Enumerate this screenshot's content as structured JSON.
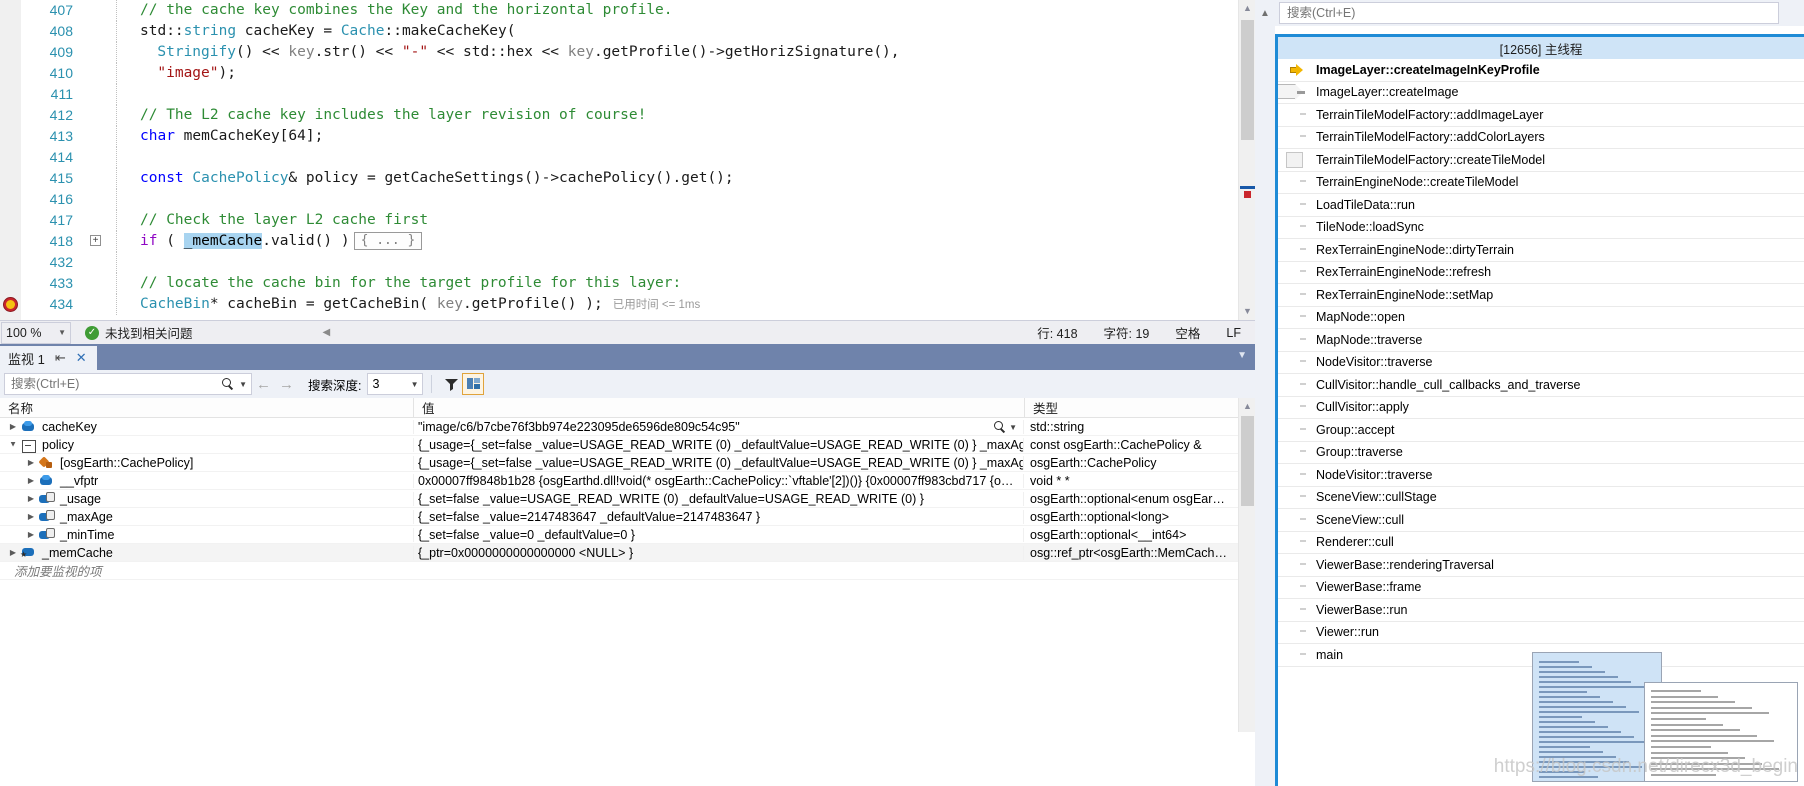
{
  "editor": {
    "zoom": "100 %",
    "issue_status": "未找到相关问题",
    "status_line": "行: 418",
    "status_char": "字符: 19",
    "status_spaces": "空格",
    "status_eol": "LF",
    "lines": [
      {
        "num": "407",
        "outline": "",
        "segments": [
          {
            "text": "// the cache key combines the Key and the horizontal profile.",
            "cls": "c-comment"
          }
        ]
      },
      {
        "num": "408",
        "outline": "",
        "segments": [
          {
            "text": "std",
            "cls": "c-plain"
          },
          {
            "text": "::",
            "cls": "c-plain"
          },
          {
            "text": "string",
            "cls": "c-type"
          },
          {
            "text": " cacheKey = ",
            "cls": "c-plain"
          },
          {
            "text": "Cache",
            "cls": "c-type"
          },
          {
            "text": "::makeCacheKey(",
            "cls": "c-plain"
          }
        ]
      },
      {
        "num": "409",
        "outline": "",
        "indent": 2,
        "segments": [
          {
            "text": "Stringify",
            "cls": "c-type"
          },
          {
            "text": "() << ",
            "cls": "c-plain"
          },
          {
            "text": "key",
            "cls": "c-var"
          },
          {
            "text": ".str() << ",
            "cls": "c-plain"
          },
          {
            "text": "\"-\"",
            "cls": "c-str"
          },
          {
            "text": " << std::hex << ",
            "cls": "c-plain"
          },
          {
            "text": "key",
            "cls": "c-var"
          },
          {
            "text": ".getProfile()->getHorizSignature(),",
            "cls": "c-plain"
          }
        ]
      },
      {
        "num": "410",
        "outline": "",
        "indent": 2,
        "segments": [
          {
            "text": "\"image\"",
            "cls": "c-str"
          },
          {
            "text": ");",
            "cls": "c-plain"
          }
        ]
      },
      {
        "num": "411",
        "outline": "",
        "segments": []
      },
      {
        "num": "412",
        "outline": "",
        "segments": [
          {
            "text": "// The L2 cache key includes the layer revision of course!",
            "cls": "c-comment"
          }
        ]
      },
      {
        "num": "413",
        "outline": "",
        "segments": [
          {
            "text": "char",
            "cls": "c-kw"
          },
          {
            "text": " memCacheKey[",
            "cls": "c-plain"
          },
          {
            "text": "64",
            "cls": "c-num"
          },
          {
            "text": "];",
            "cls": "c-plain"
          }
        ]
      },
      {
        "num": "414",
        "outline": "",
        "segments": []
      },
      {
        "num": "415",
        "outline": "",
        "segments": [
          {
            "text": "const",
            "cls": "c-kw"
          },
          {
            "text": " ",
            "cls": "c-plain"
          },
          {
            "text": "CachePolicy",
            "cls": "c-type"
          },
          {
            "text": "& policy = getCacheSettings()->cachePolicy().get();",
            "cls": "c-plain"
          }
        ]
      },
      {
        "num": "416",
        "outline": "",
        "segments": []
      },
      {
        "num": "417",
        "outline": "",
        "segments": [
          {
            "text": "// Check the layer L2 cache first",
            "cls": "c-comment"
          }
        ]
      },
      {
        "num": "418",
        "outline": "+",
        "segments": [
          {
            "text": "if",
            "cls": "c-ctl"
          },
          {
            "text": " ( ",
            "cls": "c-plain"
          },
          {
            "text": "_memCache",
            "cls": "sel-token"
          },
          {
            "text": ".valid() )",
            "cls": "c-plain"
          }
        ],
        "collapsed": "{ ... }"
      },
      {
        "num": "432",
        "outline": "",
        "segments": []
      },
      {
        "num": "433",
        "outline": "",
        "segments": [
          {
            "text": "// locate the cache bin for the target profile for this layer:",
            "cls": "c-comment"
          }
        ]
      },
      {
        "num": "434",
        "outline": "",
        "breakpoint": true,
        "segments": [
          {
            "text": "CacheBin",
            "cls": "c-type"
          },
          {
            "text": "* cacheBin = getCacheBin( ",
            "cls": "c-plain"
          },
          {
            "text": "key",
            "cls": "c-var"
          },
          {
            "text": ".getProfile() );",
            "cls": "c-plain"
          }
        ],
        "elapsed": "已用时间 <= 1ms"
      }
    ]
  },
  "watch": {
    "tab_label": "监视 1",
    "pin_icon": "pin-icon",
    "close_icon": "close-icon",
    "search_placeholder": "搜索(Ctrl+E)",
    "search_value": "",
    "depth_label": "搜索深度:",
    "depth_value": "3",
    "columns": [
      "名称",
      "值",
      "类型"
    ],
    "add_item_hint": "添加要监视的项",
    "rows": [
      {
        "name": "cacheKey",
        "indent": 0,
        "icon": "field",
        "expander": "collapsed",
        "value": "\"image/c6/b7cbe76f3bb974e223095de6596de809c54c95\"",
        "type": "std::string",
        "has_search": true,
        "highlight": false
      },
      {
        "name": "policy",
        "indent": 0,
        "icon": "expander-box",
        "expander": "expanded",
        "value": "{_usage={_set=false _value=USAGE_READ_WRITE (0) _defaultValue=USAGE_READ_WRITE (0) } _maxAge…",
        "type": "const osgEarth::CachePolicy &",
        "has_search": false,
        "highlight": false
      },
      {
        "name": "[osgEarth::CachePolicy]",
        "indent": 1,
        "icon": "base",
        "expander": "collapsed",
        "value": "{_usage={_set=false _value=USAGE_READ_WRITE (0) _defaultValue=USAGE_READ_WRITE (0) } _maxAge…",
        "type": "osgEarth::CachePolicy",
        "has_search": false,
        "highlight": false
      },
      {
        "name": "__vfptr",
        "indent": 1,
        "icon": "field",
        "expander": "collapsed",
        "value": "0x00007ff9848b1b28 {osgEarthd.dll!void(* osgEarth::CachePolicy::`vftable'[2])()} {0x00007ff983cbd717 {o…",
        "type": "void * *",
        "has_search": false,
        "highlight": false
      },
      {
        "name": "_usage",
        "indent": 1,
        "icon": "priv",
        "expander": "collapsed",
        "value": "{_set=false _value=USAGE_READ_WRITE (0) _defaultValue=USAGE_READ_WRITE (0) }",
        "type": "osgEarth::optional<enum osgEar…",
        "has_search": false,
        "highlight": false
      },
      {
        "name": "_maxAge",
        "indent": 1,
        "icon": "priv",
        "expander": "collapsed",
        "value": "{_set=false _value=2147483647 _defaultValue=2147483647 }",
        "type": "osgEarth::optional<long>",
        "has_search": false,
        "highlight": false
      },
      {
        "name": "_minTime",
        "indent": 1,
        "icon": "priv",
        "expander": "collapsed",
        "value": "{_set=false _value=0 _defaultValue=0 }",
        "type": "osgEarth::optional<__int64>",
        "has_search": false,
        "highlight": false
      },
      {
        "name": "_memCache",
        "indent": 0,
        "icon": "refptr",
        "expander": "collapsed",
        "value": "{_ptr=0x0000000000000000 <NULL> }",
        "type": "osg::ref_ptr<osgEarth::MemCach…",
        "has_search": false,
        "highlight": true
      }
    ]
  },
  "callstack": {
    "search_placeholder": "搜索(Ctrl+E)",
    "search_value": "",
    "thread_header": "[12656] 主线程",
    "frames": [
      {
        "label": "ImageLayer::createImageInKeyProfile",
        "marker": "current-arrow"
      },
      {
        "label": "ImageLayer::createImage",
        "marker": "ghost"
      },
      {
        "label": "TerrainTileModelFactory::addImageLayer",
        "marker": ""
      },
      {
        "label": "TerrainTileModelFactory::addColorLayers",
        "marker": ""
      },
      {
        "label": "TerrainTileModelFactory::createTileModel",
        "marker": "box"
      },
      {
        "label": "TerrainEngineNode::createTileModel",
        "marker": ""
      },
      {
        "label": "LoadTileData::run",
        "marker": ""
      },
      {
        "label": "TileNode::loadSync",
        "marker": ""
      },
      {
        "label": "RexTerrainEngineNode::dirtyTerrain",
        "marker": ""
      },
      {
        "label": "RexTerrainEngineNode::refresh",
        "marker": ""
      },
      {
        "label": "RexTerrainEngineNode::setMap",
        "marker": ""
      },
      {
        "label": "MapNode::open",
        "marker": ""
      },
      {
        "label": "MapNode::traverse",
        "marker": ""
      },
      {
        "label": "NodeVisitor::traverse",
        "marker": ""
      },
      {
        "label": "CullVisitor::handle_cull_callbacks_and_traverse",
        "marker": ""
      },
      {
        "label": "CullVisitor::apply",
        "marker": ""
      },
      {
        "label": "Group::accept",
        "marker": ""
      },
      {
        "label": "Group::traverse",
        "marker": ""
      },
      {
        "label": "NodeVisitor::traverse",
        "marker": ""
      },
      {
        "label": "SceneView::cullStage",
        "marker": ""
      },
      {
        "label": "SceneView::cull",
        "marker": ""
      },
      {
        "label": "Renderer::cull",
        "marker": ""
      },
      {
        "label": "ViewerBase::renderingTraversal",
        "marker": ""
      },
      {
        "label": "ViewerBase::frame",
        "marker": ""
      },
      {
        "label": "ViewerBase::run",
        "marker": ""
      },
      {
        "label": "Viewer::run",
        "marker": ""
      },
      {
        "label": "main",
        "marker": ""
      }
    ]
  },
  "watermark": "https://blog.csdn.net/direcx3d_begin"
}
